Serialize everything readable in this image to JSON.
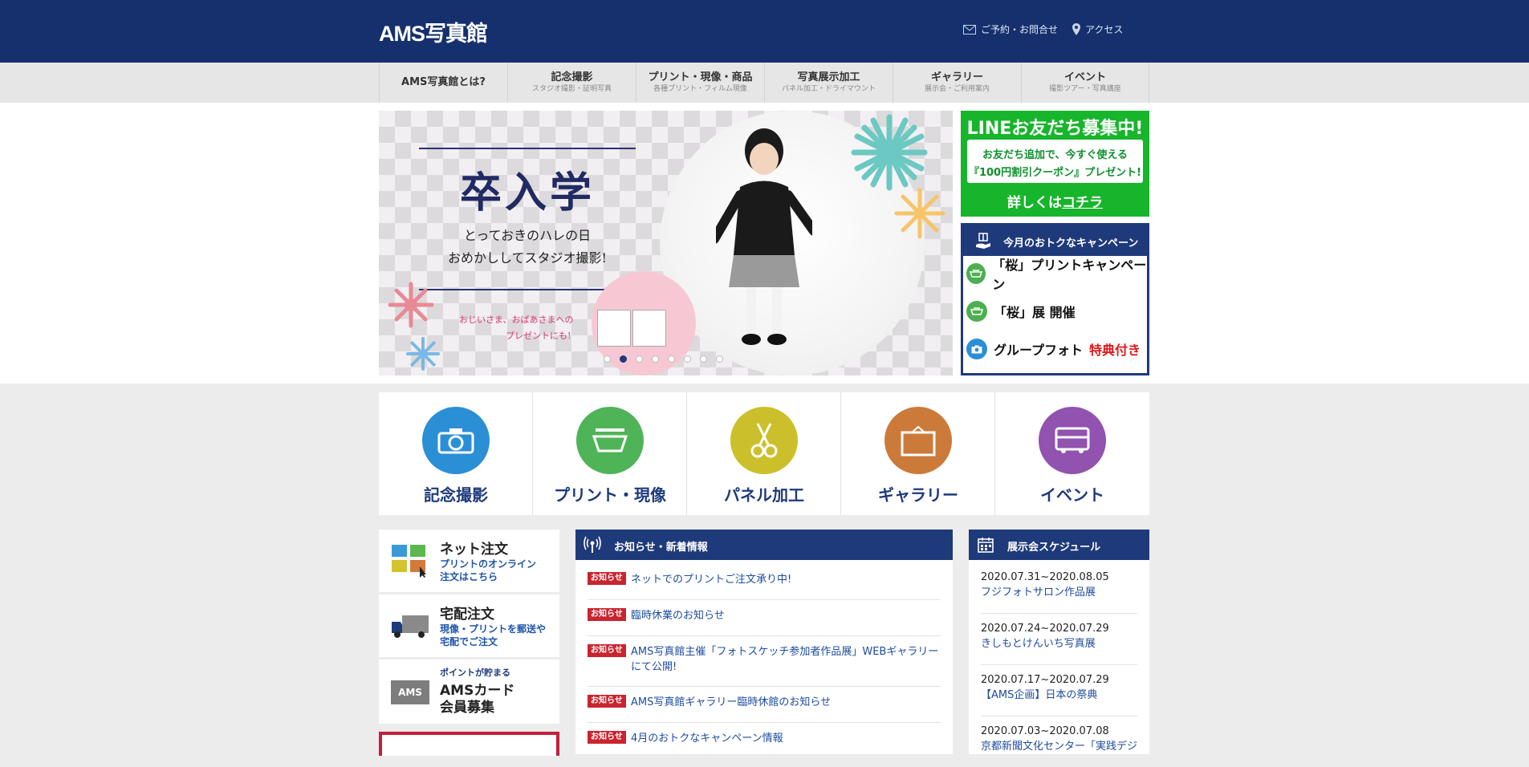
{
  "header": {
    "logo": "AMS写真館",
    "contact_label": "ご予約・お問合せ",
    "access_label": "アクセス"
  },
  "nav": [
    {
      "main": "AMS写真館とは?",
      "sub": ""
    },
    {
      "main": "記念撮影",
      "sub": "スタジオ撮影・証明写真"
    },
    {
      "main": "プリント・現像・商品",
      "sub": "各種プリント・フィルム現像"
    },
    {
      "main": "写真展示加工",
      "sub": "パネル加工・ドライマウント"
    },
    {
      "main": "ギャラリー",
      "sub": "展示会・ご利用案内"
    },
    {
      "main": "イベント",
      "sub": "撮影ツアー・写真講座"
    }
  ],
  "hero": {
    "title": "卒入学",
    "line1": "とっておきのハレの日",
    "line2": "おめかししてスタジオ撮影!",
    "pink1": "おじいさま、おばあさまへの",
    "pink2": "プレゼントにも!",
    "slide_count": 8,
    "active_slide": 2
  },
  "line_banner": {
    "title": "LINEお友だち募集中!",
    "line1": "お友だち追加で、今すぐ使える",
    "line2": "『100円割引クーポン』プレゼント!",
    "more_prefix": "詳しくは",
    "more_link": "コチラ"
  },
  "campaign": {
    "title": "今月のおトクなキャンペーン",
    "items": [
      {
        "text": "「桜」プリントキャンペーン",
        "highlight": "",
        "icon": "printer-icon",
        "color": "#4caf50"
      },
      {
        "text": "「桜」展 開催",
        "highlight": "",
        "icon": "printer-icon",
        "color": "#4caf50"
      },
      {
        "text": "グループフォト",
        "highlight": "特典付き",
        "icon": "camera-icon",
        "color": "#2b8fd6"
      }
    ]
  },
  "categories": [
    {
      "label": "記念撮影",
      "color": "#2b8fd6",
      "icon": "camera-icon"
    },
    {
      "label": "プリント・現像",
      "color": "#4fb457",
      "icon": "printer-icon"
    },
    {
      "label": "パネル加工",
      "color": "#cbc02b",
      "icon": "scissors-icon"
    },
    {
      "label": "ギャラリー",
      "color": "#cc7a3a",
      "icon": "frame-icon"
    },
    {
      "label": "イベント",
      "color": "#9152b0",
      "icon": "bus-icon"
    }
  ],
  "side_menu": {
    "net_order": {
      "title": "ネット注文",
      "sub1": "プリントのオンライン",
      "sub2": "注文はこちら"
    },
    "delivery": {
      "title": "宅配注文",
      "sub1": "現像・プリントを郵送や",
      "sub2": "宅配でご注文"
    },
    "card": {
      "small": "ポイントが貯まる",
      "title1": "AMSカード",
      "title2": "会員募集",
      "logo": "AMS"
    }
  },
  "news": {
    "title": "お知らせ・新着情報",
    "tag": "お知らせ",
    "items": [
      "ネットでのプリントご注文承り中!",
      "臨時休業のお知らせ",
      "AMS写真館主催「フォトスケッチ参加者作品展」WEBギャラリーにて公開!",
      "AMS写真館ギャラリー臨時休館のお知らせ",
      "4月のおトクなキャンペーン情報"
    ]
  },
  "schedule": {
    "title": "展示会スケジュール",
    "items": [
      {
        "date": "2020.07.31~2020.08.05",
        "name": "フジフォトサロン作品展"
      },
      {
        "date": "2020.07.24~2020.07.29",
        "name": "きしもとけんいち写真展"
      },
      {
        "date": "2020.07.17~2020.07.29",
        "name": "【AMS企画】日本の祭典"
      },
      {
        "date": "2020.07.03~2020.07.08",
        "name": "京都新聞文化センター「実践デジ"
      }
    ]
  }
}
